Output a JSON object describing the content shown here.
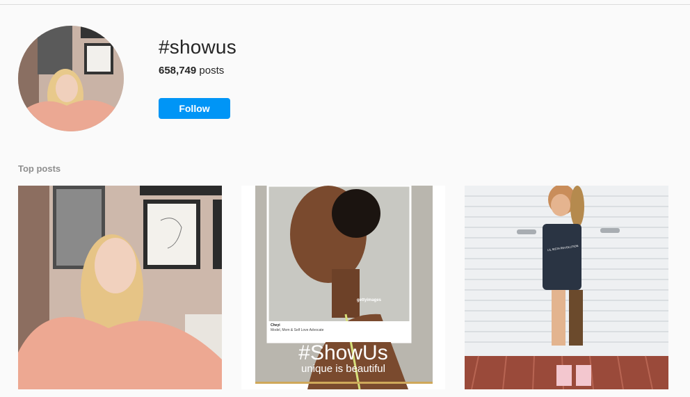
{
  "header": {
    "hashtag": "#showus",
    "posts_count": "658,749",
    "posts_label": " posts",
    "follow_label": "Follow"
  },
  "section": {
    "title": "Top posts"
  },
  "posts": [
    {
      "alt": "woman in pink sweatsuit"
    },
    {
      "overlay_title": "#ShowUs",
      "overlay_sub": "unique is beautiful",
      "caption_name": "Cheyi",
      "caption_sub": "Model, Mom & Self Love Advocate",
      "watermark": "gettyimages"
    },
    {
      "shirt_text": "LIL SISTA REVOLUTION"
    }
  ],
  "colors": {
    "follow_button": "#0095f6",
    "background": "#fafafa",
    "muted_text": "#8e8e8e"
  }
}
